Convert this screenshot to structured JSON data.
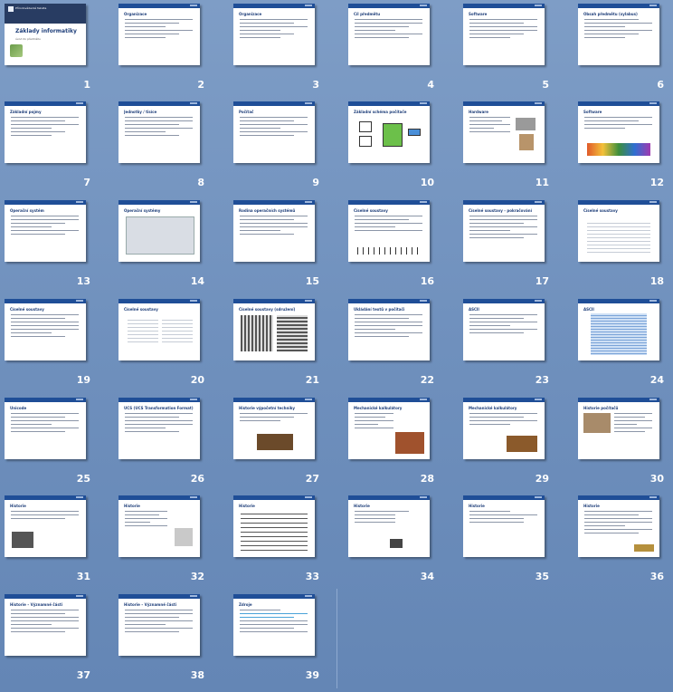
{
  "presentation": {
    "title_slide": {
      "institution": "Přírodovědecká fakulta",
      "title": "Základy informatiky",
      "subtitle": "úvod do předmětu"
    },
    "slides": [
      {
        "n": "1",
        "title": "Základy informatiky"
      },
      {
        "n": "2",
        "title": "Organizace"
      },
      {
        "n": "3",
        "title": "Organizace"
      },
      {
        "n": "4",
        "title": "Cíl předmětu"
      },
      {
        "n": "5",
        "title": "Software"
      },
      {
        "n": "6",
        "title": "Obsah předmětu (sylabus)"
      },
      {
        "n": "7",
        "title": "Základní pojmy"
      },
      {
        "n": "8",
        "title": "Jednotky / tisíce"
      },
      {
        "n": "9",
        "title": "Počítač"
      },
      {
        "n": "10",
        "title": "Základní schéma počítače"
      },
      {
        "n": "11",
        "title": "Hardware"
      },
      {
        "n": "12",
        "title": "Software"
      },
      {
        "n": "13",
        "title": "Operační systém"
      },
      {
        "n": "14",
        "title": "Operační systémy"
      },
      {
        "n": "15",
        "title": "Rodina operačních systémů"
      },
      {
        "n": "16",
        "title": "Číselné soustavy"
      },
      {
        "n": "17",
        "title": "Číselné soustavy - pokračování"
      },
      {
        "n": "18",
        "title": "Číselné soustavy"
      },
      {
        "n": "19",
        "title": "Číselné soustavy"
      },
      {
        "n": "20",
        "title": "Číselné soustavy"
      },
      {
        "n": "21",
        "title": "Číselné soustavy (sdružení)"
      },
      {
        "n": "22",
        "title": "Ukládání textů v počítači"
      },
      {
        "n": "23",
        "title": "ASCII"
      },
      {
        "n": "24",
        "title": "ASCII"
      },
      {
        "n": "25",
        "title": "Unicode"
      },
      {
        "n": "26",
        "title": "UCS (UCS Transformation Format)"
      },
      {
        "n": "27",
        "title": "Historie výpočetní techniky"
      },
      {
        "n": "28",
        "title": "Mechanické kalkulátory"
      },
      {
        "n": "29",
        "title": "Mechanické kalkulátory"
      },
      {
        "n": "30",
        "title": "Historie počítačů"
      },
      {
        "n": "31",
        "title": "Historie"
      },
      {
        "n": "32",
        "title": "Historie"
      },
      {
        "n": "33",
        "title": "Historie"
      },
      {
        "n": "34",
        "title": "Historie"
      },
      {
        "n": "35",
        "title": "Historie"
      },
      {
        "n": "36",
        "title": "Historie"
      },
      {
        "n": "37",
        "title": "Historie – Významné části"
      },
      {
        "n": "38",
        "title": "Historie – Významné části"
      },
      {
        "n": "39",
        "title": "Zdroje"
      }
    ]
  }
}
